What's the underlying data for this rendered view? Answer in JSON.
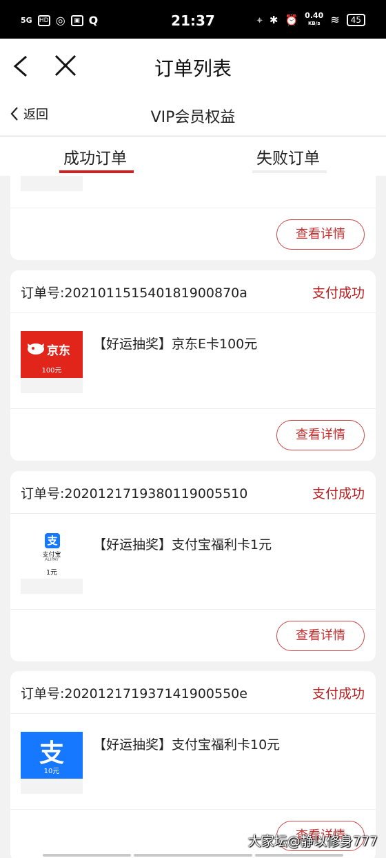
{
  "status_bar": {
    "time": "21:37",
    "network": "5G",
    "net_speed_value": "0.40",
    "net_speed_unit": "KB/s",
    "battery": "45"
  },
  "app_bar": {
    "title": "订单列表"
  },
  "sub_bar": {
    "back_label": "返回",
    "title": "VIP会员权益"
  },
  "tabs": [
    {
      "label": "成功订单",
      "active": true
    },
    {
      "label": "失败订单",
      "active": false
    }
  ],
  "partial_card": {
    "detail_button": "查看详情"
  },
  "orders": [
    {
      "order_no": "订单号:20210115154018190087​0a",
      "status": "支付成功",
      "item_title": "【好运抽奖】京东E卡100元",
      "thumb_brand": "京东",
      "thumb_amount": "100元",
      "detail_button": "查看详情"
    },
    {
      "order_no": "订单号:20201217193801190055​10",
      "status": "支付成功",
      "item_title": "【好运抽奖】支付宝福利卡1元",
      "thumb_glyph": "支",
      "thumb_brand": "支付宝",
      "thumb_sub": "ALIPAY",
      "thumb_amount": "1元",
      "detail_button": "查看详情"
    },
    {
      "order_no": "订单号:20201217193714190055​0e",
      "status": "支付成功",
      "item_title": "【好运抽奖】支付宝福利卡10元",
      "thumb_glyph": "支",
      "thumb_amount": "10元",
      "detail_button": "查看详情"
    }
  ],
  "watermark": "大家坛@静以修身777",
  "colors": {
    "accent": "#d21f1f",
    "status": "#b81c1c",
    "jd_red": "#e1251b",
    "alipay_blue": "#1677ff"
  }
}
